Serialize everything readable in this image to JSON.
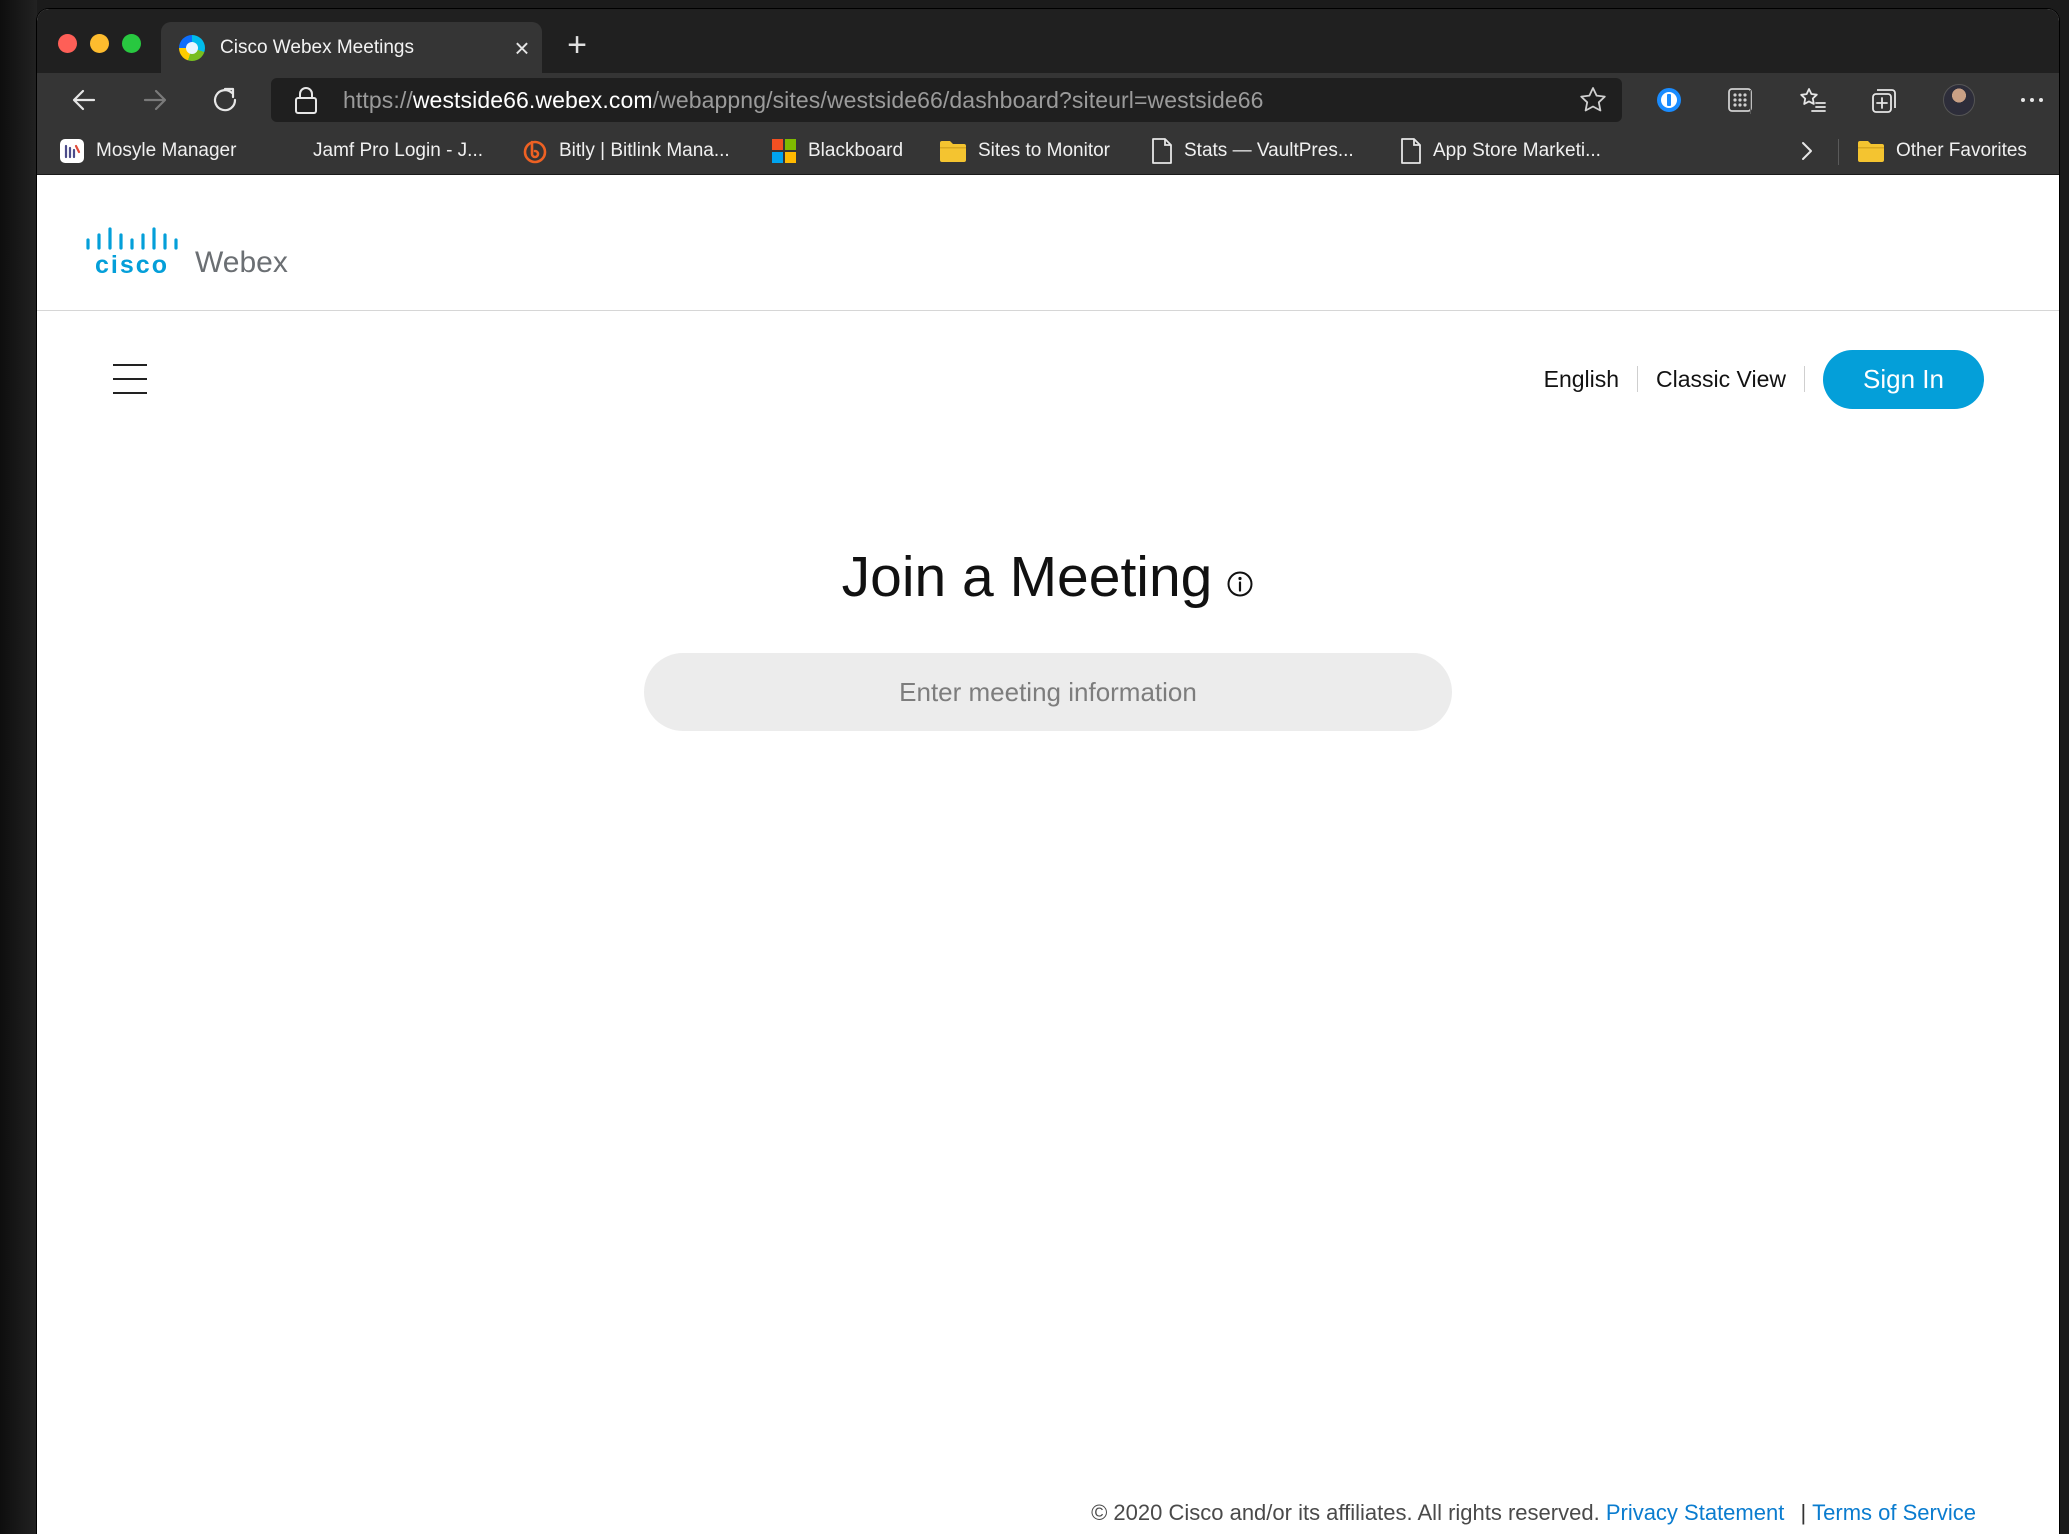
{
  "browser": {
    "tab_title": "Cisco Webex Meetings",
    "tab_close_icon": "×",
    "new_tab_icon": "+",
    "url_scheme": "https://",
    "url_host": "westside66.webex.com",
    "url_path": "/webappng/sites/westside66/dashboard?siteurl=westside66",
    "bookmarks": [
      {
        "label": "Mosyle Manager",
        "icon": "mosyle-icon"
      },
      {
        "label": "Jamf Pro Login - J...",
        "icon": "none"
      },
      {
        "label": "Bitly | Bitlink Mana...",
        "icon": "bitly-icon"
      },
      {
        "label": "Blackboard",
        "icon": "microsoft-icon"
      },
      {
        "label": "Sites to Monitor",
        "icon": "folder-icon"
      },
      {
        "label": "Stats — VaultPres...",
        "icon": "page-icon"
      },
      {
        "label": "App Store Marketi...",
        "icon": "page-icon"
      }
    ],
    "other_favorites": "Other Favorites"
  },
  "site": {
    "logo_cisco": "cisco",
    "logo_webex": "Webex",
    "nav": {
      "language": "English",
      "classic_view": "Classic View",
      "sign_in": "Sign In"
    }
  },
  "main": {
    "title": "Join a Meeting",
    "input_placeholder": "Enter meeting information"
  },
  "footer": {
    "copyright": "© 2020 Cisco and/or its affiliates. All rights reserved.",
    "privacy": "Privacy Statement",
    "separator": "|",
    "terms": "Terms of Service"
  },
  "colors": {
    "accent": "#049fd9",
    "link": "#0a7ccf",
    "browser_chrome": "#353535"
  }
}
